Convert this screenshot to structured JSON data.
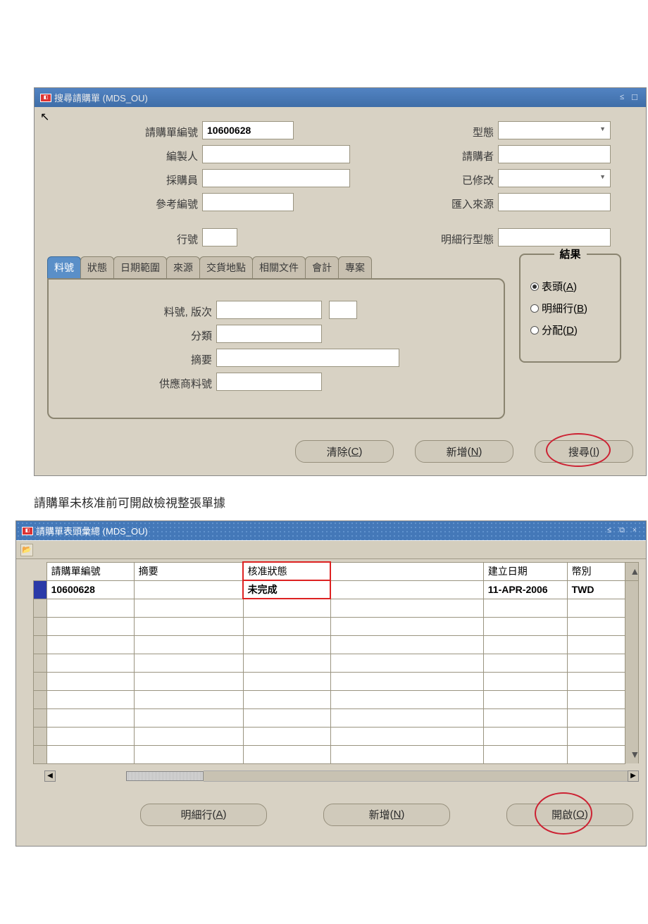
{
  "window1": {
    "title": "搜尋請購單 (MDS_OU)",
    "fields": {
      "reqNumberLabel": "請購單編號",
      "reqNumberValue": "10600628",
      "typeLabel": "型態",
      "preparerLabel": "編製人",
      "requesterLabel": "請購者",
      "buyerLabel": "採購員",
      "modifiedLabel": "已修改",
      "refNumberLabel": "參考編號",
      "importSourceLabel": "匯入來源",
      "lineNumberLabel": "行號",
      "lineTypeLabel": "明細行型態"
    },
    "tabs": [
      "料號",
      "狀態",
      "日期範圍",
      "來源",
      "交貨地點",
      "相關文件",
      "會計",
      "專案"
    ],
    "tabPanel": {
      "itemRevLabel": "料號, 版次",
      "categoryLabel": "分類",
      "descriptionLabel": "摘要",
      "supplierItemLabel": "供應商料號"
    },
    "resultGroup": {
      "title": "結果",
      "options": [
        {
          "label": "表頭",
          "accel": "A",
          "checked": true
        },
        {
          "label": "明細行",
          "accel": "B",
          "checked": false
        },
        {
          "label": "分配",
          "accel": "D",
          "checked": false
        }
      ]
    },
    "buttons": {
      "clear": {
        "label": "清除",
        "accel": "C"
      },
      "new": {
        "label": "新增",
        "accel": "N"
      },
      "search": {
        "label": "搜尋",
        "accel": "I"
      }
    }
  },
  "intertext": "請購單未核准前可開啟檢視整張單據",
  "window2": {
    "title": "請購單表頭彙總 (MDS_OU)",
    "columns": {
      "reqNo": "請購單編號",
      "desc": "摘要",
      "approvalStatus": "核准狀態",
      "blank": "",
      "createdDate": "建立日期",
      "currency": "幣別"
    },
    "rows": [
      {
        "reqNo": "10600628",
        "desc": "",
        "approvalStatus": "未完成",
        "blank": "",
        "createdDate": "11-APR-2006",
        "currency": "TWD",
        "selected": true
      }
    ],
    "emptyRows": 9,
    "buttons": {
      "lines": {
        "label": "明細行",
        "accel": "A"
      },
      "new": {
        "label": "新增",
        "accel": "N"
      },
      "open": {
        "label": "開啟",
        "accel": "O"
      }
    }
  }
}
